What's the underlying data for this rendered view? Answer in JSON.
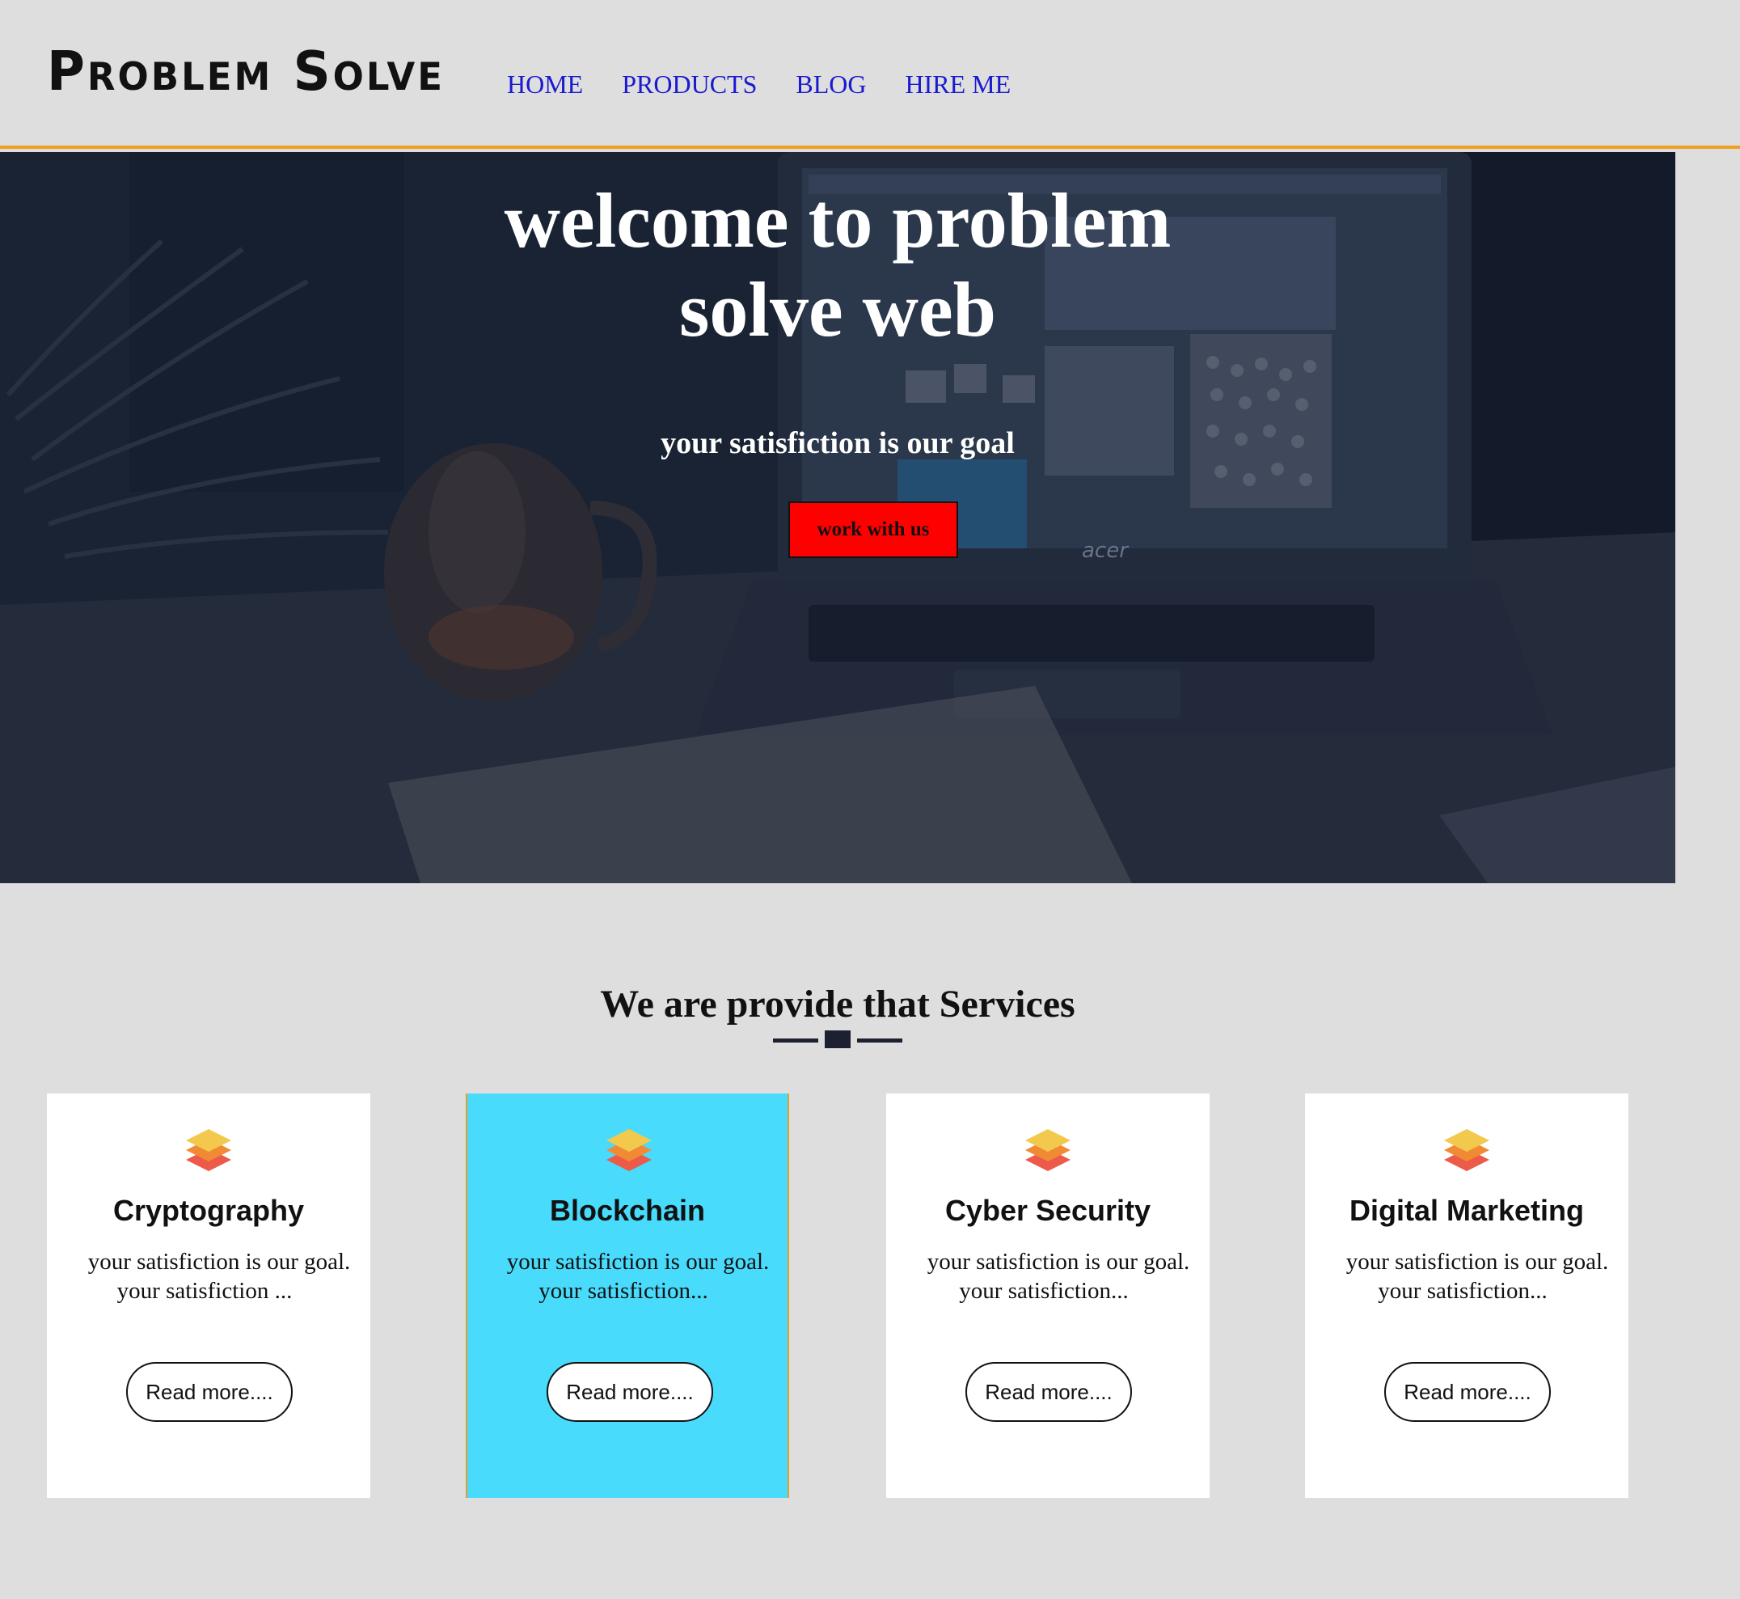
{
  "header": {
    "logo": "Problem Solve",
    "nav": [
      "HOME",
      "PRODUCTS",
      "BLOG",
      "HIRE ME"
    ]
  },
  "hero": {
    "title": "welcome to problem solve web",
    "subtitle": "your satisfiction is our goal",
    "button": "work with us",
    "laptop_brand": "acer"
  },
  "services": {
    "title": "We are provide that Services",
    "cards": [
      {
        "title": "Cryptography",
        "text_line1": "your satisfiction is our goal.",
        "text_line2": "your satisfiction ...",
        "button": "Read more....",
        "icon": "layers-icon"
      },
      {
        "title": "Blockchain",
        "text_line1": "your satisfiction is our goal.",
        "text_line2": "your satisfiction...",
        "button": "Read more....",
        "icon": "layers-icon"
      },
      {
        "title": "Cyber Security",
        "text_line1": "your satisfiction is our goal.",
        "text_line2": "your satisfiction...",
        "button": "Read more....",
        "icon": "layers-icon"
      },
      {
        "title": "Digital Marketing",
        "text_line1": "your satisfiction is our goal.",
        "text_line2": "your satisfiction...",
        "button": "Read more....",
        "icon": "layers-icon"
      }
    ]
  },
  "colors": {
    "page_bg": "#dedede",
    "nav_link": "#1a1ad0",
    "header_border": "#f0a020",
    "hero_button": "#ff0000",
    "active_card": "#48dbfb"
  }
}
